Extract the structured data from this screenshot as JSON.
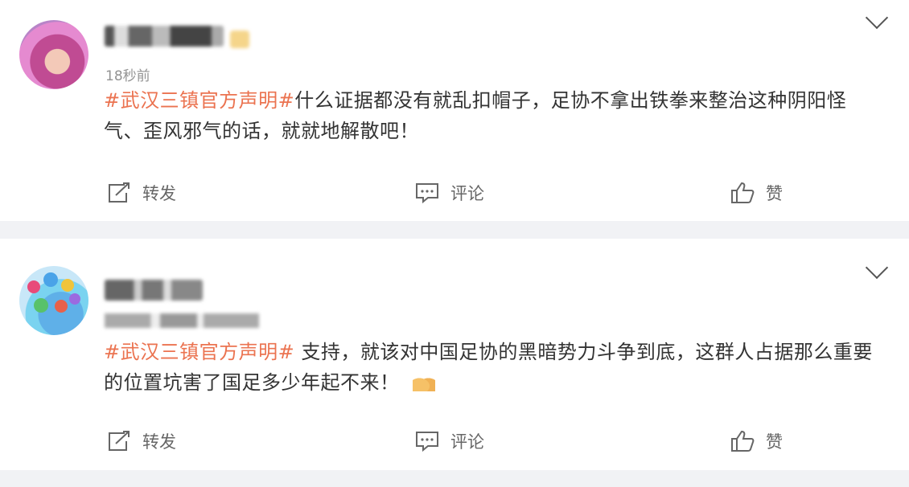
{
  "posts": [
    {
      "time": "18秒前",
      "hashtag": "#武汉三镇官方声明#",
      "text": "什么证据都没有就乱扣帽子，足协不拿出铁拳来整治这种阴阳怪气、歪风邪气的话，就就地解散吧！",
      "actions": {
        "repost": "转发",
        "comment": "评论",
        "like": "赞"
      }
    },
    {
      "hashtag": "#武汉三镇官方声明#",
      "text": " 支持，就该对中国足协的黑暗势力斗争到底，这群人占据那么重要的位置坑害了国足多少年起不来！",
      "emoji": "clapping-hands-icon",
      "actions": {
        "repost": "转发",
        "comment": "评论",
        "like": "赞"
      }
    }
  ],
  "colors": {
    "hashtag": "#eb7350",
    "background": "#f1f2f5",
    "card": "#ffffff"
  }
}
